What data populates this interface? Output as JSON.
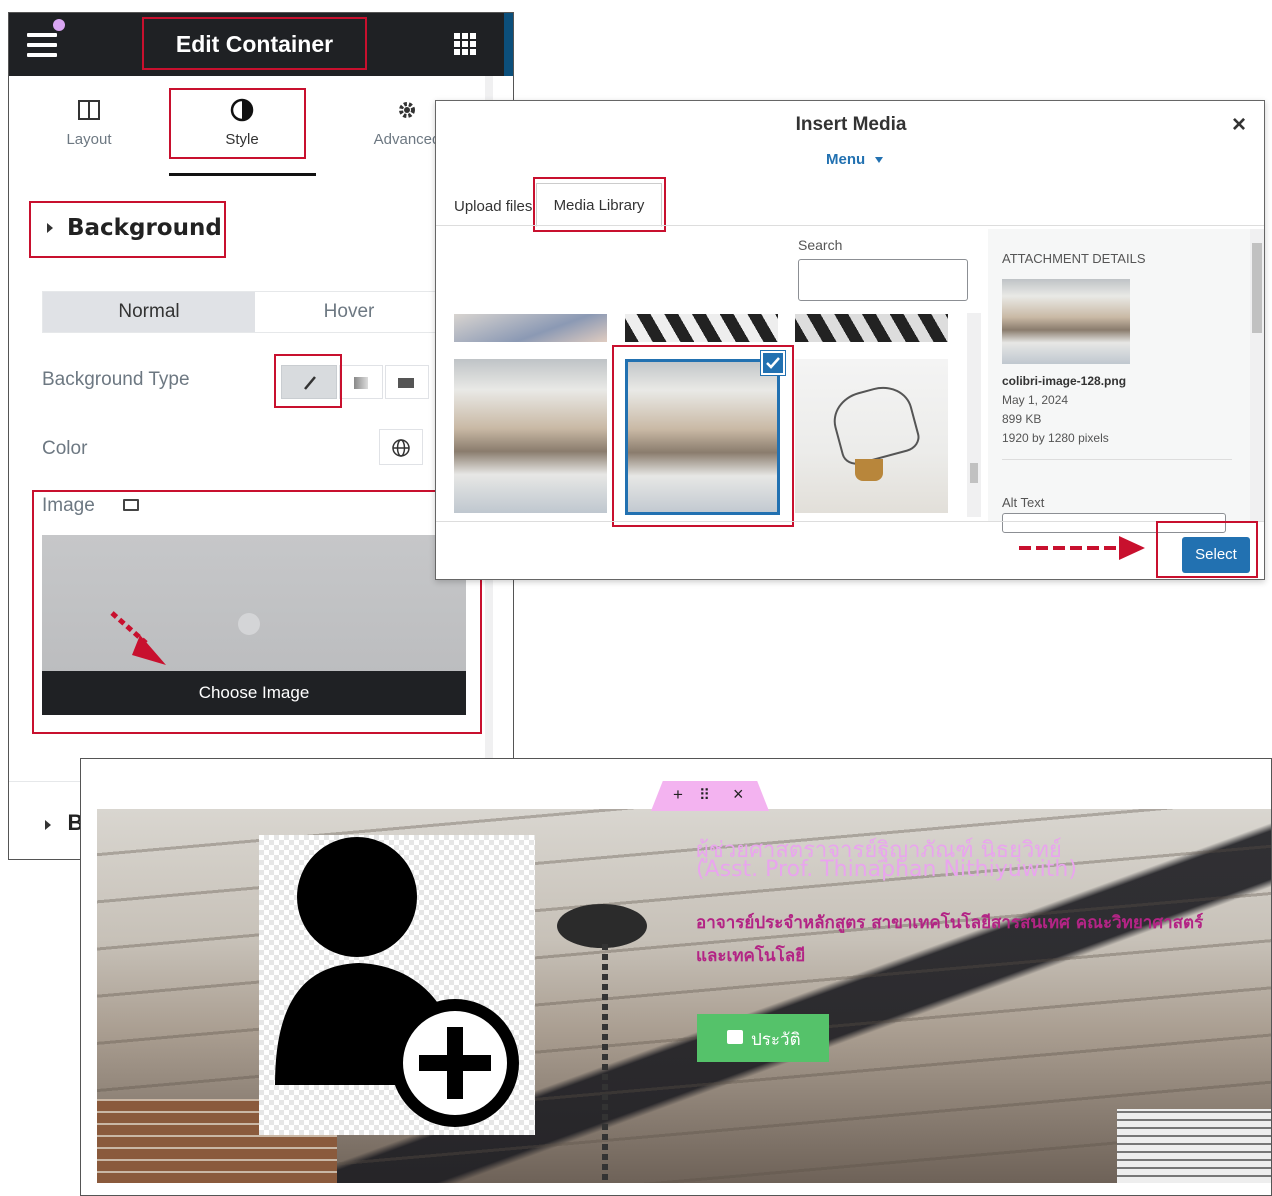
{
  "elementor": {
    "header_title": "Edit Container",
    "tabs": [
      {
        "label": "Layout",
        "icon": "layout-icon"
      },
      {
        "label": "Style",
        "icon": "style-half-circle-icon"
      },
      {
        "label": "Advanced",
        "icon": "gear-icon"
      }
    ],
    "section_title": "Background",
    "state_tabs": {
      "normal": "Normal",
      "hover": "Hover"
    },
    "background_type_label": "Background Type",
    "color_label": "Color",
    "image_label": "Image",
    "choose_image_label": "Choose Image",
    "next_section_initial": "B"
  },
  "media_modal": {
    "title": "Insert Media",
    "menu_label": "Menu",
    "tabs": {
      "upload": "Upload files",
      "library": "Media Library"
    },
    "search_label": "Search",
    "search_value": "",
    "details": {
      "heading": "ATTACHMENT DETAILS",
      "filename": "colibri-image-128.png",
      "date": "May 1, 2024",
      "size": "899 KB",
      "dimensions": "1920 by 1280 pixels",
      "alt_text_label": "Alt Text"
    },
    "select_button": "Select",
    "close_symbol": "×"
  },
  "editor_preview": {
    "toolbar": {
      "add": "+",
      "move": "⠿",
      "close": "×"
    },
    "name_th": "ผู้ช่วยศาสตราจารย์ฐิญาภัณฑ์ นิธยุวิทย์",
    "name_en": "(Asst. Prof. Thinaphan Nithiyuwith)",
    "position_line1": "อาจารย์ประจำหลักสูตร สาขาเทคโนโลยีสารสนเทศ คณะวิทยาศาสตร์",
    "position_line2": "และเทคโนโลยี",
    "history_button": "ประวัติ"
  },
  "colors": {
    "accent_red": "#c8102e",
    "wp_blue": "#2271b1",
    "pink_title": "#e9a5ee",
    "magenta_text": "#b32485",
    "green_button": "#55c26a",
    "toolbar_pink": "#f3b3f0"
  }
}
